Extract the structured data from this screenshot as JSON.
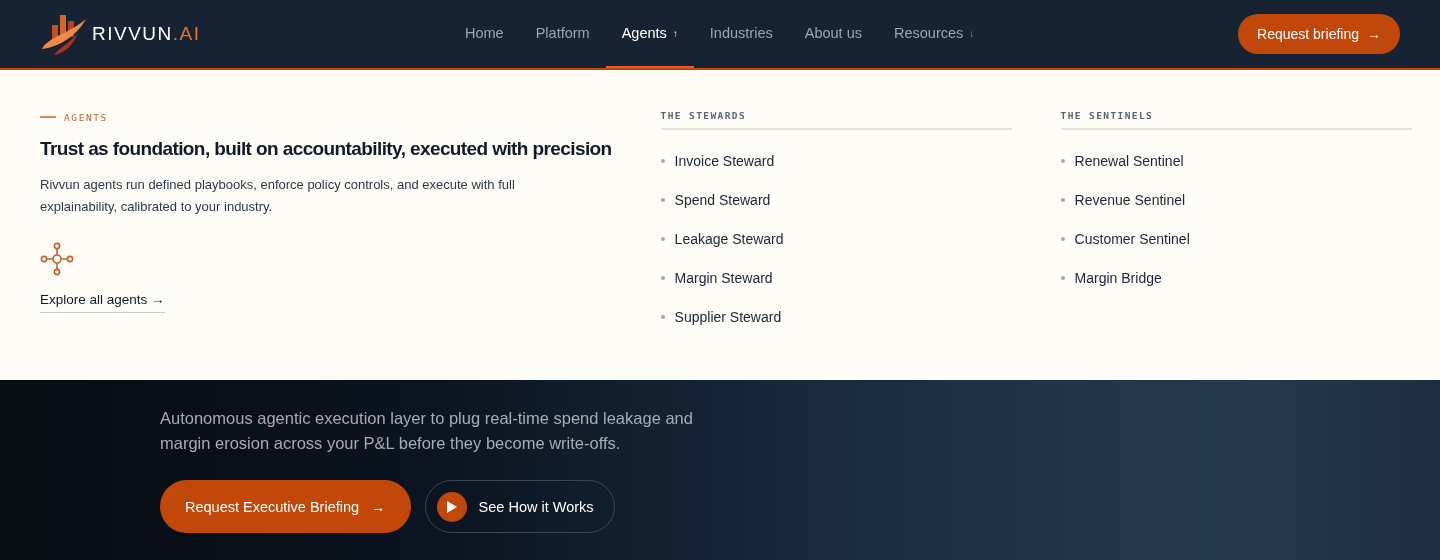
{
  "logo": {
    "name": "RIVVUN",
    "suffix": ".AI"
  },
  "nav": [
    {
      "label": "Home",
      "selected": false
    },
    {
      "label": "Platform",
      "selected": false
    },
    {
      "label": "Agents",
      "selected": true,
      "caret": "↑"
    },
    {
      "label": "Industries",
      "selected": false
    },
    {
      "label": "About us",
      "selected": false
    },
    {
      "label": "Resources",
      "selected": false,
      "caret": "↓"
    }
  ],
  "cta": {
    "label": "Request briefing",
    "arrow": "→"
  },
  "dropdown": {
    "eyebrow": "AGENTS",
    "title": "Trust as foundation, built on accountability, executed with precision",
    "description": "Rivvun agents run defined playbooks, enforce policy controls, and execute with full explainability, calibrated to your industry.",
    "link": "Explore all agents →",
    "groups": [
      {
        "heading": "THE STEWARDS",
        "items": [
          "Invoice Steward",
          "Spend Steward",
          "Leakage Steward",
          "Margin Steward",
          "Supplier Steward"
        ]
      },
      {
        "heading": "THE SENTINELS",
        "items": [
          "Renewal Sentinel",
          "Revenue Sentinel",
          "Customer Sentinel",
          "Margin Bridge"
        ]
      }
    ]
  },
  "hero": {
    "subtitle": "Autonomous agentic execution layer to plug real-time spend leakage and margin erosion across your P&L before they become write-offs.",
    "buttons": [
      {
        "kind": "primary",
        "label": "Request Executive Briefing",
        "arrow": "→"
      },
      {
        "kind": "secondary",
        "label": "See How it Works"
      }
    ]
  }
}
